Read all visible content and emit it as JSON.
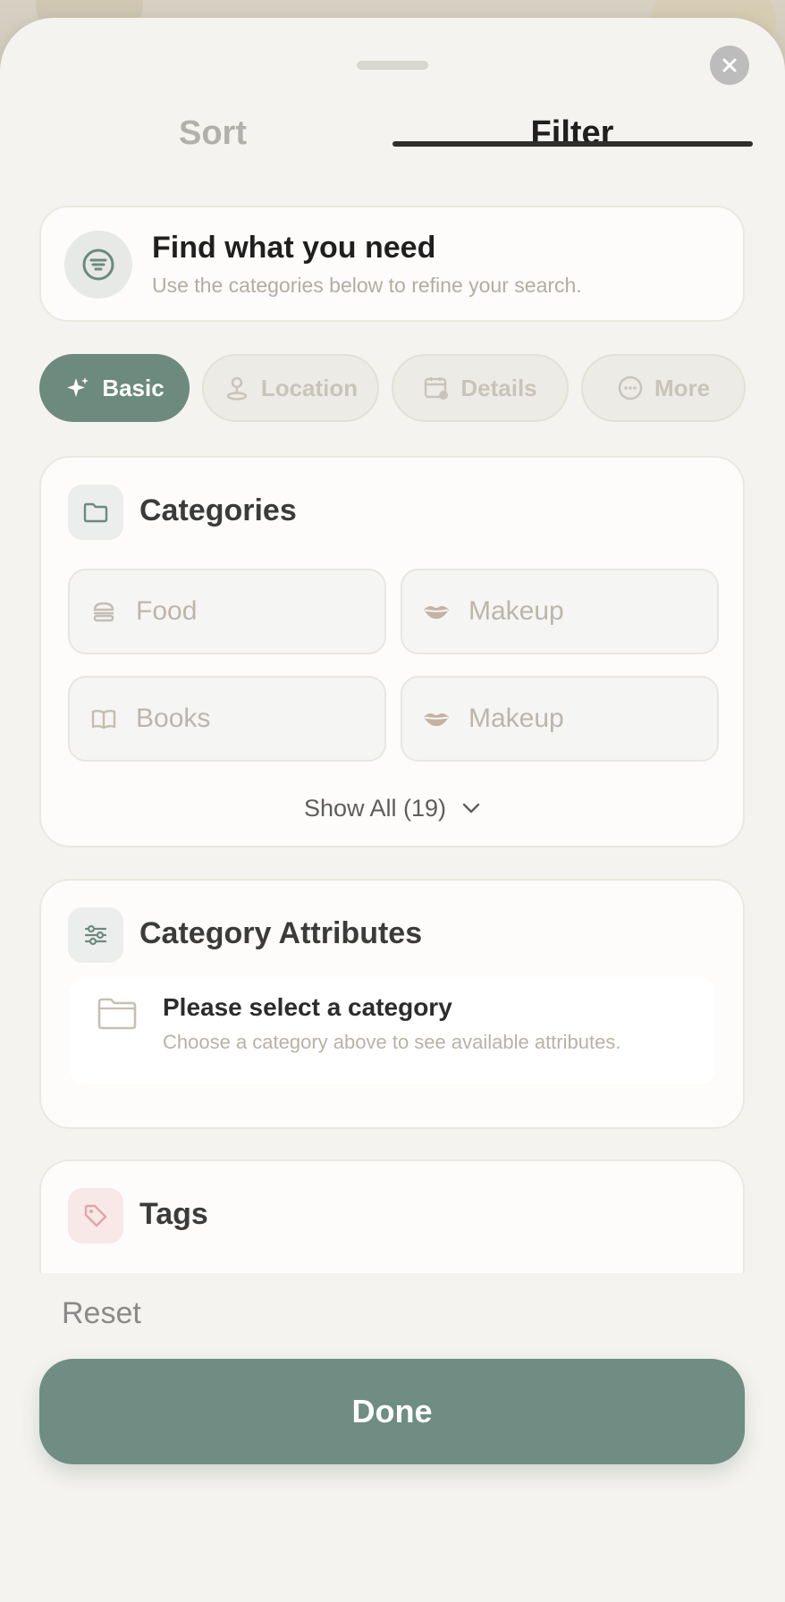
{
  "tabs": [
    {
      "label": "Sort",
      "active": false
    },
    {
      "label": "Filter",
      "active": true
    }
  ],
  "info": {
    "title": "Find what you need",
    "subtitle": "Use the categories below to refine your search."
  },
  "chips": [
    {
      "label": "Basic",
      "icon": "sparkle-icon",
      "active": true
    },
    {
      "label": "Location",
      "icon": "map-pin-icon",
      "active": false
    },
    {
      "label": "Details",
      "icon": "calendar-icon",
      "active": false
    },
    {
      "label": "More",
      "icon": "more-dots-icon",
      "active": false
    }
  ],
  "categories": {
    "title": "Categories",
    "items": [
      {
        "label": "Food",
        "icon": "burger-icon"
      },
      {
        "label": "Makeup",
        "icon": "lips-icon"
      },
      {
        "label": "Books",
        "icon": "book-icon"
      },
      {
        "label": "Makeup",
        "icon": "lips-icon"
      }
    ],
    "show_all": "Show All (19)"
  },
  "attributes": {
    "title": "Category Attributes",
    "empty_title": "Please select a category",
    "empty_subtitle": "Choose a category above to see available attributes."
  },
  "tags": {
    "title": "Tags"
  },
  "footer": {
    "reset": "Reset",
    "done": "Done"
  },
  "colors": {
    "accent": "#6f8d82",
    "active_chip": "#6c8a7e",
    "sheet_bg": "#f4f3ef"
  }
}
